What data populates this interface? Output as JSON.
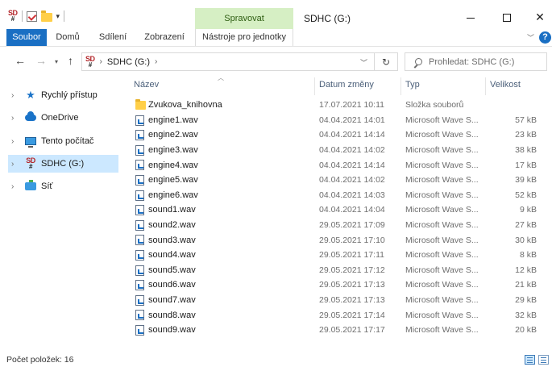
{
  "titlebar": {
    "logo_top": "SD",
    "logo_bottom": "#",
    "context_tab": "Spravovat",
    "window_title": "SDHC (G:)",
    "min_label": "",
    "max_label": "",
    "close_label": "✕"
  },
  "ribbon": {
    "tabs": [
      "Soubor",
      "Domů",
      "Sdílení",
      "Zobrazení",
      "Nástroje pro jednotky"
    ],
    "help": "?"
  },
  "address": {
    "path": "SDHC (G:)",
    "search_placeholder": "Prohledat: SDHC (G:)"
  },
  "sidebar": {
    "items": [
      {
        "label": "Rychlý přístup",
        "icon": "star-icon"
      },
      {
        "label": "OneDrive",
        "icon": "cloud-icon"
      },
      {
        "label": "Tento počítač",
        "icon": "computer-icon"
      },
      {
        "label": "SDHC (G:)",
        "icon": "sd-card-icon"
      },
      {
        "label": "Síť",
        "icon": "network-icon"
      }
    ]
  },
  "columns": {
    "name": "Název",
    "date": "Datum změny",
    "type": "Typ",
    "size": "Velikost"
  },
  "files": [
    {
      "name": "Zvukova_knihovna",
      "date": "17.07.2021 10:11",
      "type": "Složka souborů",
      "size": "",
      "icon": "folder-icon"
    },
    {
      "name": "engine1.wav",
      "date": "04.04.2021 14:01",
      "type": "Microsoft Wave S...",
      "size": "57 kB",
      "icon": "wav-icon"
    },
    {
      "name": "engine2.wav",
      "date": "04.04.2021 14:14",
      "type": "Microsoft Wave S...",
      "size": "23 kB",
      "icon": "wav-icon"
    },
    {
      "name": "engine3.wav",
      "date": "04.04.2021 14:02",
      "type": "Microsoft Wave S...",
      "size": "38 kB",
      "icon": "wav-icon"
    },
    {
      "name": "engine4.wav",
      "date": "04.04.2021 14:14",
      "type": "Microsoft Wave S...",
      "size": "17 kB",
      "icon": "wav-icon"
    },
    {
      "name": "engine5.wav",
      "date": "04.04.2021 14:02",
      "type": "Microsoft Wave S...",
      "size": "39 kB",
      "icon": "wav-icon"
    },
    {
      "name": "engine6.wav",
      "date": "04.04.2021 14:03",
      "type": "Microsoft Wave S...",
      "size": "52 kB",
      "icon": "wav-icon"
    },
    {
      "name": "sound1.wav",
      "date": "04.04.2021 14:04",
      "type": "Microsoft Wave S...",
      "size": "9 kB",
      "icon": "wav-icon"
    },
    {
      "name": "sound2.wav",
      "date": "29.05.2021 17:09",
      "type": "Microsoft Wave S...",
      "size": "27 kB",
      "icon": "wav-icon"
    },
    {
      "name": "sound3.wav",
      "date": "29.05.2021 17:10",
      "type": "Microsoft Wave S...",
      "size": "30 kB",
      "icon": "wav-icon"
    },
    {
      "name": "sound4.wav",
      "date": "29.05.2021 17:11",
      "type": "Microsoft Wave S...",
      "size": "8 kB",
      "icon": "wav-icon"
    },
    {
      "name": "sound5.wav",
      "date": "29.05.2021 17:12",
      "type": "Microsoft Wave S...",
      "size": "12 kB",
      "icon": "wav-icon"
    },
    {
      "name": "sound6.wav",
      "date": "29.05.2021 17:13",
      "type": "Microsoft Wave S...",
      "size": "21 kB",
      "icon": "wav-icon"
    },
    {
      "name": "sound7.wav",
      "date": "29.05.2021 17:13",
      "type": "Microsoft Wave S...",
      "size": "29 kB",
      "icon": "wav-icon"
    },
    {
      "name": "sound8.wav",
      "date": "29.05.2021 17:14",
      "type": "Microsoft Wave S...",
      "size": "32 kB",
      "icon": "wav-icon"
    },
    {
      "name": "sound9.wav",
      "date": "29.05.2021 17:17",
      "type": "Microsoft Wave S...",
      "size": "20 kB",
      "icon": "wav-icon"
    }
  ],
  "status": {
    "count": "Počet položek: 16"
  },
  "colors": {
    "file_tab": "#1a6fc3",
    "context_tab": "#d6efc4",
    "selection": "#cce8ff"
  }
}
